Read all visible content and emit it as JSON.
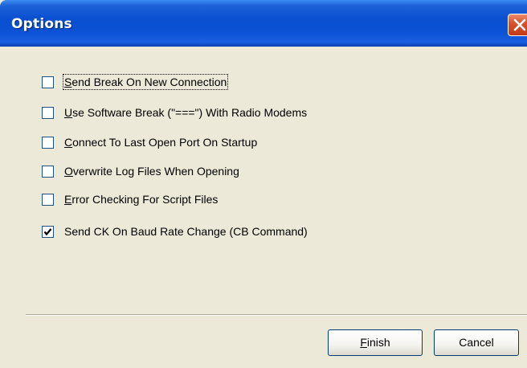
{
  "window": {
    "title": "Options",
    "close_icon": "close-x-icon"
  },
  "options": [
    {
      "label": "Send Break On New Connection",
      "access_key": "S",
      "rest": "end Break On New Connection",
      "checked": false
    },
    {
      "label": "Use Software Break (\"===\") With Radio Modems",
      "access_key": "U",
      "rest": "se Software Break (\"===\") With Radio Modems",
      "checked": false
    },
    {
      "label": "Connect To Last Open Port On Startup",
      "access_key": "C",
      "rest": "onnect To Last Open Port On Startup",
      "checked": false
    },
    {
      "label": "Overwrite Log Files When Opening",
      "access_key": "O",
      "rest": "verwrite Log Files When Opening",
      "checked": false
    },
    {
      "label": "Error Checking For Script Files",
      "access_key": "E",
      "rest": "rror Checking For Script Files",
      "checked": false
    },
    {
      "label": "Send CK On Baud Rate Change (CB Command)",
      "access_key": "",
      "rest": "Send CK On Baud Rate Change (CB Command)",
      "checked": true
    }
  ],
  "buttons": {
    "finish_key": "F",
    "finish_rest": "inish",
    "finish_label": "Finish",
    "cancel_label": "Cancel"
  },
  "colors": {
    "titlebar": "#0a4fd0",
    "close": "#d9542c",
    "dialog_bg": "#ece9d8",
    "checkbox_border": "#1c5180"
  }
}
